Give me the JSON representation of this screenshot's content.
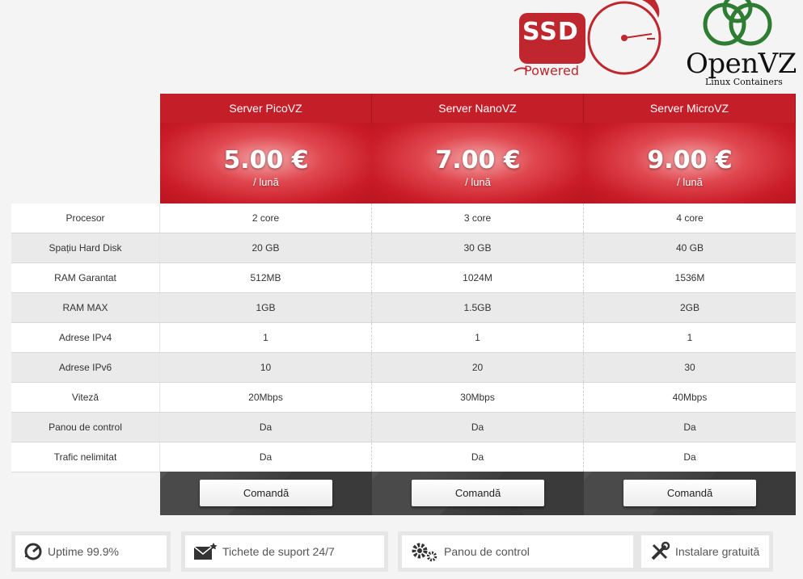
{
  "logos": {
    "ssd_label": "SSD",
    "ssd_sub": "Powered",
    "openvz_label": "OpenVZ",
    "openvz_sub": "Linux Containers"
  },
  "plans": [
    {
      "name": "Server PicoVZ",
      "price": "5.00 €",
      "period": "/ lună",
      "order": "Comandă"
    },
    {
      "name": "Server NanoVZ",
      "price": "7.00 €",
      "period": "/ lună",
      "order": "Comandă"
    },
    {
      "name": "Server MicroVZ",
      "price": "9.00 €",
      "period": "/ lună",
      "order": "Comandă"
    }
  ],
  "rows": [
    {
      "label": "Procesor",
      "values": [
        "2 core",
        "3 core",
        "4 core"
      ]
    },
    {
      "label": "Spațiu Hard Disk",
      "values": [
        "20 GB",
        "30 GB",
        "40 GB"
      ]
    },
    {
      "label": "RAM Garantat",
      "values": [
        "512MB",
        "1024M",
        "1536M"
      ]
    },
    {
      "label": "RAM MAX",
      "values": [
        "1GB",
        "1.5GB",
        "2GB"
      ]
    },
    {
      "label": "Adrese IPv4",
      "values": [
        "1",
        "1",
        "1"
      ]
    },
    {
      "label": "Adrese IPv6",
      "values": [
        "10",
        "20",
        "30"
      ]
    },
    {
      "label": "Viteză",
      "values": [
        "20Mbps",
        "30Mbps",
        "40Mbps"
      ]
    },
    {
      "label": "Panou de control",
      "values": [
        "Da",
        "Da",
        "Da"
      ]
    },
    {
      "label": "Trafic nelimitat",
      "values": [
        "Da",
        "Da",
        "Da"
      ]
    }
  ],
  "features": [
    {
      "label": "Uptime 99.9%",
      "icon": "gauge-icon"
    },
    {
      "label": "Tichete de suport 24/7",
      "icon": "envelope-icon"
    },
    {
      "label": "Panou de control",
      "icon": "gears-icon"
    },
    {
      "label": "Instalare gratuită",
      "icon": "tools-icon"
    }
  ],
  "colors": {
    "accent": "#c41e29",
    "dark_footer": "#3e3e3e"
  }
}
